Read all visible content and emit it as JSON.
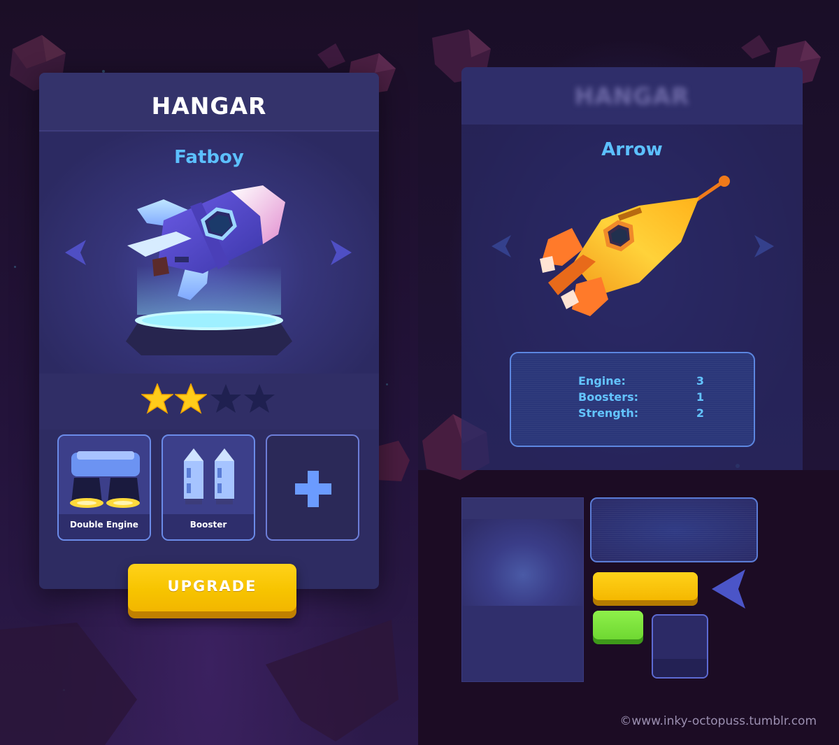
{
  "left_panel": {
    "title": "HANGAR",
    "ship_name": "Fatboy",
    "rating": {
      "filled": 2,
      "total": 4
    },
    "slots": [
      {
        "label": "Double Engine",
        "icon": "double-engine-icon"
      },
      {
        "label": "Booster",
        "icon": "booster-icon"
      },
      {
        "label": "",
        "icon": "plus-icon"
      }
    ],
    "upgrade_label": "UPGRADE"
  },
  "right_panel": {
    "title": "HANGAR",
    "ship_name": "Arrow",
    "stats": [
      {
        "label": "Engine:",
        "value": "3"
      },
      {
        "label": "Boosters:",
        "value": "1"
      },
      {
        "label": "Strength:",
        "value": "2"
      }
    ]
  },
  "credit": "©www.inky-octopuss.tumblr.com",
  "colors": {
    "accent_blue": "#5cc0ff",
    "button_yellow": "#f7c400",
    "button_green": "#6fd832",
    "panel": "#2e2c62",
    "star_gold": "#ffcc1a"
  }
}
